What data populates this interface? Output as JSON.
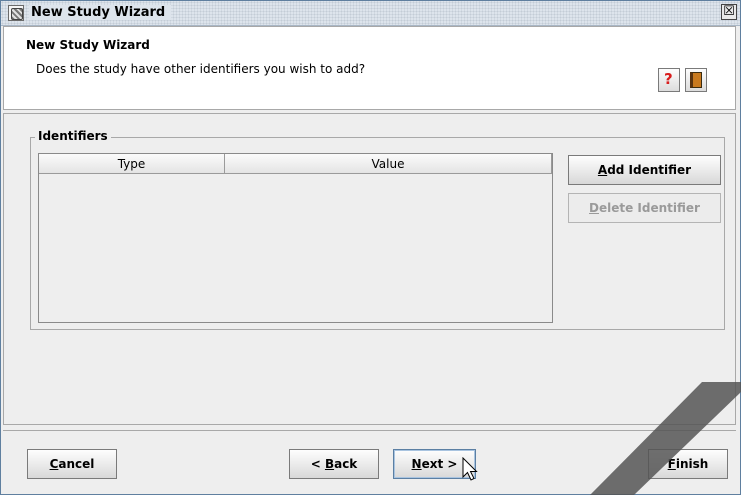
{
  "window": {
    "title": "New Study Wizard",
    "close_symbol": "☒"
  },
  "header": {
    "title": "New Study Wizard",
    "subtitle": "Does the study have other identifiers you wish to add?",
    "help_symbol": "?"
  },
  "identifiers": {
    "group_label": "Identifiers",
    "columns": [
      "Type",
      "Value"
    ],
    "rows": []
  },
  "actions": {
    "add_identifier": {
      "mnemonic": "A",
      "rest": "dd Identifier"
    },
    "delete_identifier": {
      "mnemonic": "D",
      "rest": "elete Identifier"
    }
  },
  "footer": {
    "cancel": {
      "mnemonic": "C",
      "rest": "ancel"
    },
    "back": {
      "prefix": "< ",
      "mnemonic": "B",
      "rest": "ack"
    },
    "next": {
      "mnemonic": "N",
      "rest": "ext >"
    },
    "finish": {
      "mnemonic": "F",
      "rest": "inish"
    }
  },
  "colors": {
    "help_icon": "#d81c1c",
    "book_icon": "#c97a1f",
    "window_bg": "#eeeeee",
    "next_focus": "#5b7fa3"
  }
}
